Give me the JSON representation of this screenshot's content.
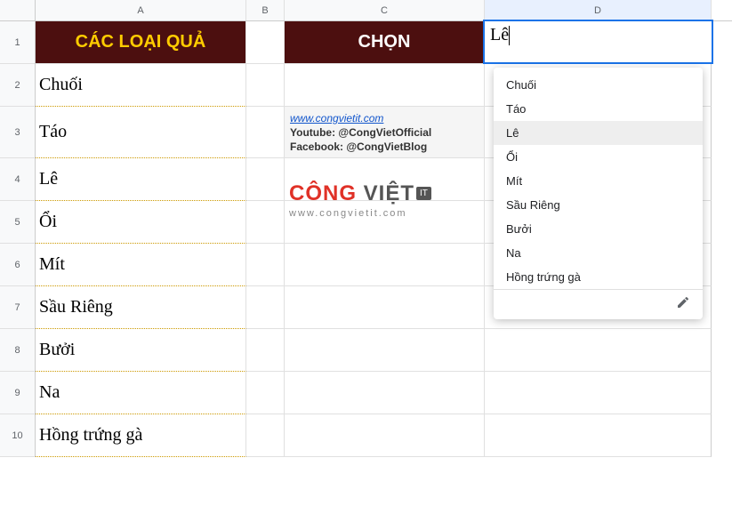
{
  "columns": {
    "A": "A",
    "B": "B",
    "C": "C",
    "D": "D"
  },
  "rows": [
    "1",
    "2",
    "3",
    "4",
    "5",
    "6",
    "7",
    "8",
    "9",
    "10"
  ],
  "header_a": "CÁC LOẠI QUẢ",
  "header_c": "CHỌN",
  "fruits": [
    "Chuối",
    "Táo",
    "Lê",
    "Ổi",
    "Mít",
    "Sầu Riêng",
    "Bưởi",
    "Na",
    "Hồng trứng gà"
  ],
  "active_value": "Lê",
  "dropdown": {
    "items": [
      "Chuối",
      "Táo",
      "Lê",
      "Ổi",
      "Mít",
      "Sầu Riêng",
      "Bưởi",
      "Na",
      "Hồng trứng gà"
    ],
    "selected_index": 2
  },
  "info": {
    "url": "www.congvietit.com",
    "youtube": "Youtube: @CongVietOfficial",
    "facebook": "Facebook: @CongVietBlog"
  },
  "logo": {
    "part1": "CÔNG",
    "part2": " VIỆT",
    "it": "IT",
    "url": "www.congvietit.com"
  }
}
